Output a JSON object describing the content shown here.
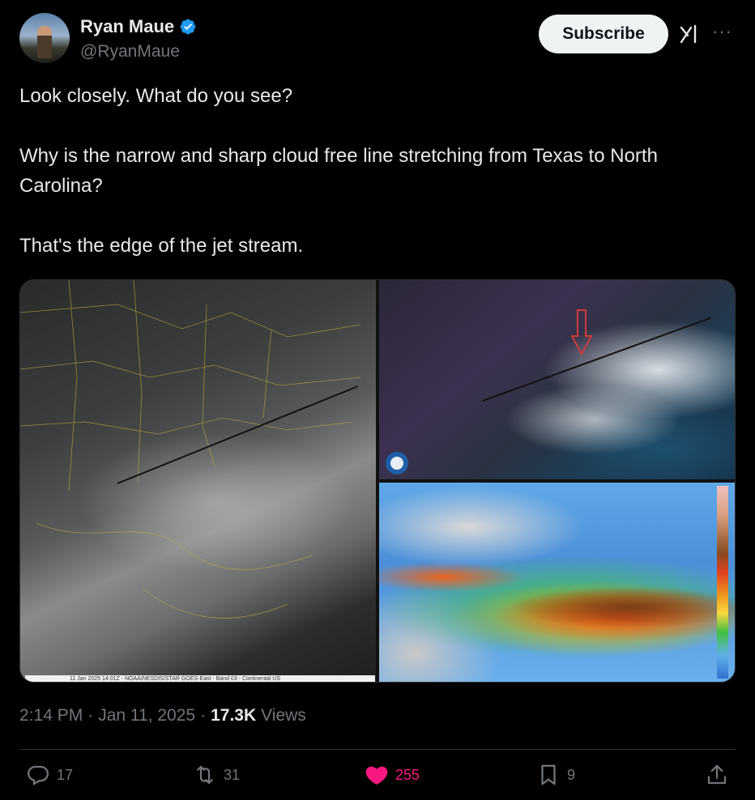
{
  "author": {
    "name": "Ryan Maue",
    "handle": "@RyanMaue",
    "verified": true
  },
  "header": {
    "subscribe_label": "Subscribe",
    "more_label": "···"
  },
  "tweet": {
    "paragraphs": [
      "Look closely.  What do you see?",
      "",
      "Why is the narrow and sharp cloud free line stretching from Texas to North Carolina?",
      "",
      "That's the edge of the jet stream."
    ]
  },
  "media": {
    "left_caption": "11 Jan 2025 14:01Z - NOAA/NESDIS/STAR GOES-East - Band 03 - Continental US"
  },
  "meta": {
    "time": "2:14 PM",
    "separator": "·",
    "date": "Jan 11, 2025",
    "views_count": "17.3K",
    "views_label": "Views"
  },
  "actions": {
    "replies": "17",
    "reposts": "31",
    "likes": "255",
    "bookmarks": "9"
  },
  "colors": {
    "background": "#000000",
    "text": "#e7e9ea",
    "secondary": "#71767b",
    "verified": "#1d9bf0",
    "like": "#f91880"
  }
}
